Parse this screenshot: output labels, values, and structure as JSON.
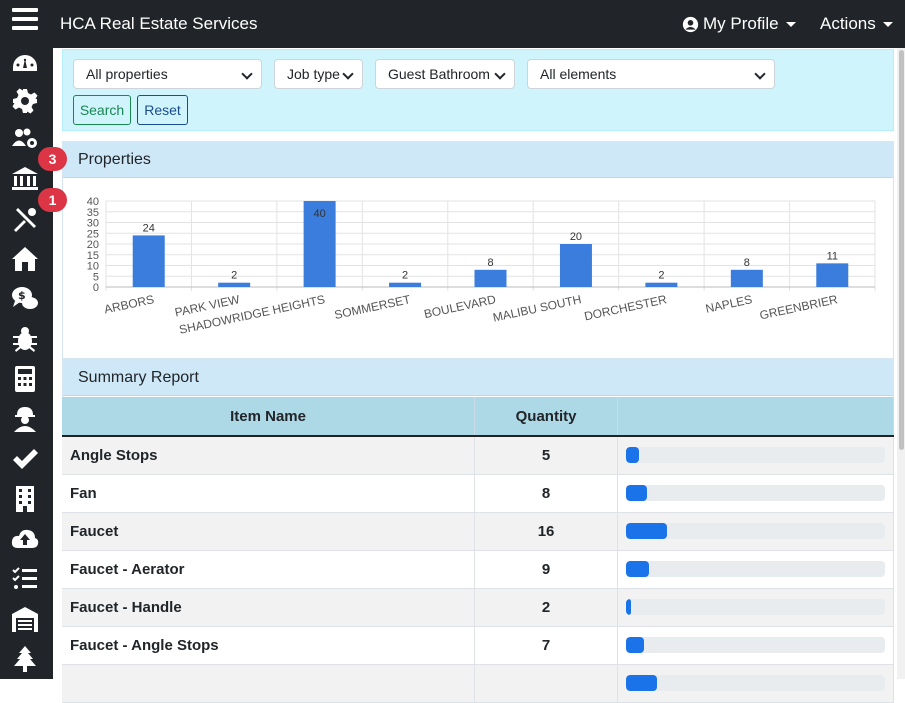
{
  "header": {
    "app_title": "HCA Real Estate Services",
    "profile_label": "My Profile",
    "actions_label": "Actions"
  },
  "sidebar": {
    "icons": [
      "dashboard-icon",
      "gear-icon",
      "users-cog-icon",
      "bank-icon",
      "tools-off-icon",
      "house-icon",
      "money-chat-icon",
      "bug-icon",
      "calculator-icon",
      "worker-icon",
      "check-icon",
      "building-icon",
      "cloud-upload-icon",
      "task-list-icon",
      "warehouse-icon",
      "tree-icon"
    ],
    "badges": {
      "bank": "3",
      "tools": "1"
    }
  },
  "filters": {
    "property_select": "All properties",
    "job_type_select": "Job type",
    "room_select": "Guest Bathroom",
    "element_select": "All elements",
    "search_label": "Search",
    "reset_label": "Reset"
  },
  "properties_card": {
    "title": "Properties"
  },
  "chart_data": {
    "type": "bar",
    "categories": [
      "ARBORS",
      "PARK VIEW",
      "SHADOWRIDGE HEIGHTS",
      "SOMMERSET",
      "BOULEVARD",
      "MALIBU SOUTH",
      "DORCHESTER",
      "NAPLES",
      "GREENBRIER"
    ],
    "values": [
      24,
      2,
      40,
      2,
      8,
      20,
      2,
      8,
      11
    ],
    "ylim": [
      0,
      40
    ],
    "yticks": [
      0,
      5,
      10,
      15,
      20,
      25,
      30,
      35,
      40
    ],
    "grid": true,
    "bar_color": "#3b7ddd"
  },
  "summary_card": {
    "title": "Summary Report",
    "columns": [
      "Item Name",
      "Quantity",
      ""
    ],
    "rows": [
      {
        "name": "Angle Stops",
        "qty": "5",
        "pct": 5
      },
      {
        "name": "Fan",
        "qty": "8",
        "pct": 8
      },
      {
        "name": "Faucet",
        "qty": "16",
        "pct": 16
      },
      {
        "name": "Faucet - Aerator",
        "qty": "9",
        "pct": 9
      },
      {
        "name": "Faucet - Handle",
        "qty": "2",
        "pct": 2
      },
      {
        "name": "Faucet - Angle Stops",
        "qty": "7",
        "pct": 7
      },
      {
        "name": "",
        "qty": "",
        "pct": 12
      }
    ]
  }
}
